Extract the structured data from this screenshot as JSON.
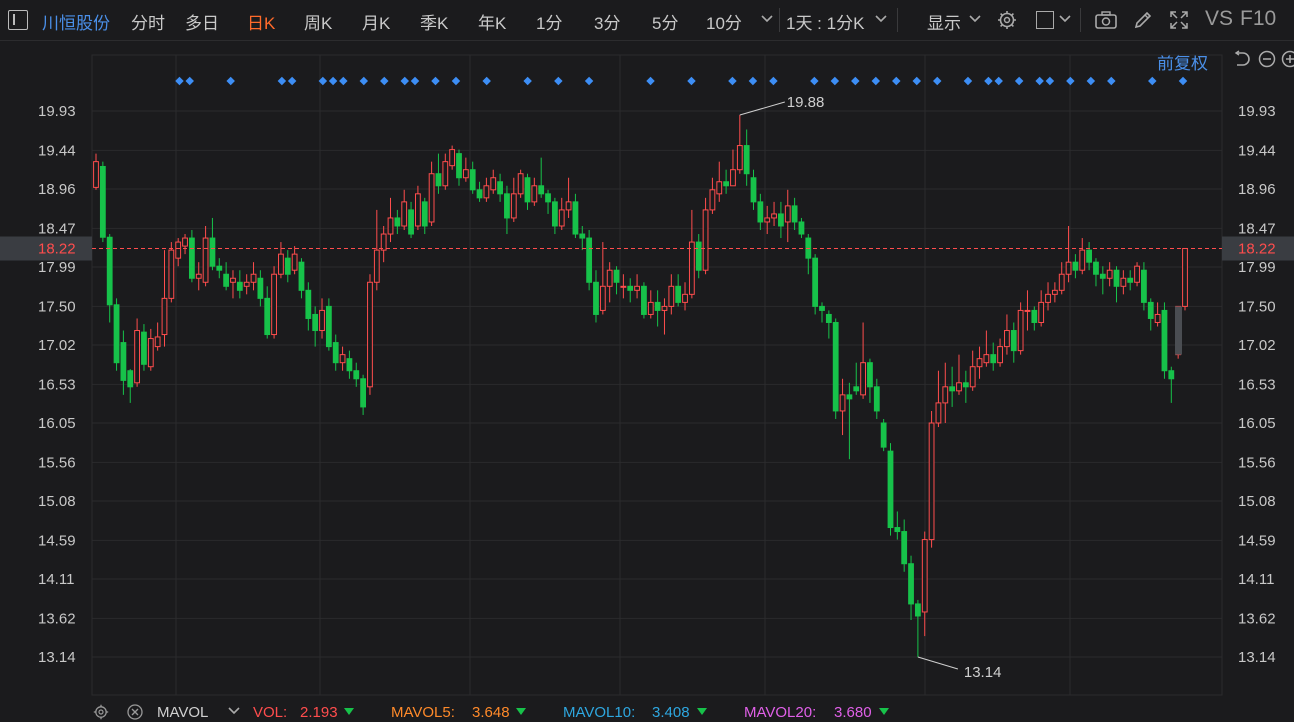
{
  "toolbar": {
    "stock_name": "川恒股份",
    "tabs": [
      "分时",
      "多日",
      "日K",
      "周K",
      "月K",
      "季K",
      "年K",
      "1分",
      "3分",
      "5分",
      "10分"
    ],
    "active_tab": "日K",
    "more": "chevron-down",
    "interval_select": "1天 : 1分K",
    "display_menu": "显示",
    "right_labels": [
      "VS",
      "F10"
    ],
    "icons": [
      "settings-icon",
      "box-toggle-icon",
      "camera-icon",
      "pencil-icon",
      "fullscreen-icon"
    ]
  },
  "adjustment": {
    "label": "前复权",
    "icons": [
      "undo-icon",
      "minus-circle-icon",
      "plus-circle-icon"
    ]
  },
  "colors": {
    "up": "#ff4d4d",
    "down": "#17c24a",
    "last_price": "#ff4d4d",
    "marker": "#3d8ef5",
    "grid": "#2b2b2d",
    "axis_text": "#c8c8c8"
  },
  "chart_data": {
    "type": "candlestick",
    "y_ticks": [
      "19.93",
      "19.44",
      "18.96",
      "18.47",
      "17.99",
      "17.50",
      "17.02",
      "16.53",
      "16.05",
      "15.56",
      "15.08",
      "14.59",
      "14.11",
      "13.62",
      "13.14"
    ],
    "ylim": [
      13.14,
      19.93
    ],
    "last_price": "18.22",
    "high_label": "19.88",
    "low_label": "13.14",
    "candles": [
      [
        18.98,
        19.3,
        19.4,
        18.95
      ],
      [
        19.24,
        18.36,
        19.3,
        18.3
      ],
      [
        18.36,
        17.52,
        18.4,
        17.3
      ],
      [
        17.52,
        16.8,
        17.6,
        16.7
      ],
      [
        17.05,
        16.58,
        17.2,
        16.4
      ],
      [
        16.7,
        16.5,
        16.72,
        16.3
      ],
      [
        16.55,
        17.2,
        17.35,
        16.5
      ],
      [
        17.18,
        16.78,
        17.28,
        16.7
      ],
      [
        16.75,
        17.1,
        17.22,
        16.7
      ],
      [
        17.0,
        17.12,
        17.3,
        16.95
      ],
      [
        17.15,
        17.6,
        18.2,
        17.0
      ],
      [
        17.6,
        18.2,
        18.3,
        17.55
      ],
      [
        18.1,
        18.3,
        18.35,
        18.0
      ],
      [
        18.25,
        18.35,
        18.4,
        18.15
      ],
      [
        18.35,
        17.85,
        18.45,
        17.8
      ],
      [
        17.85,
        17.9,
        18.05,
        17.7
      ],
      [
        17.8,
        18.35,
        18.5,
        17.75
      ],
      [
        18.35,
        18.0,
        18.6,
        17.95
      ],
      [
        18.0,
        17.95,
        18.1,
        17.85
      ],
      [
        17.9,
        17.75,
        18.05,
        17.7
      ],
      [
        17.8,
        17.85,
        17.95,
        17.6
      ],
      [
        17.8,
        17.7,
        17.95,
        17.6
      ],
      [
        17.75,
        17.8,
        17.9,
        17.65
      ],
      [
        17.8,
        17.9,
        18.05,
        17.7
      ],
      [
        17.85,
        17.6,
        17.95,
        17.5
      ],
      [
        17.6,
        17.15,
        17.75,
        17.1
      ],
      [
        17.15,
        17.9,
        18.0,
        17.1
      ],
      [
        17.9,
        18.15,
        18.3,
        17.85
      ],
      [
        18.1,
        17.9,
        18.2,
        17.8
      ],
      [
        17.95,
        18.15,
        18.25,
        17.9
      ],
      [
        18.05,
        17.7,
        18.1,
        17.6
      ],
      [
        17.7,
        17.35,
        17.8,
        17.2
      ],
      [
        17.4,
        17.2,
        17.5,
        17.0
      ],
      [
        17.2,
        17.45,
        17.6,
        17.1
      ],
      [
        17.5,
        17.0,
        17.6,
        16.95
      ],
      [
        17.05,
        16.8,
        17.15,
        16.7
      ],
      [
        16.8,
        16.9,
        17.0,
        16.7
      ],
      [
        16.85,
        16.7,
        16.95,
        16.6
      ],
      [
        16.7,
        16.6,
        16.8,
        16.5
      ],
      [
        16.6,
        16.25,
        16.65,
        16.15
      ],
      [
        16.5,
        17.8,
        17.9,
        16.4
      ],
      [
        17.8,
        18.2,
        18.7,
        17.7
      ],
      [
        18.2,
        18.4,
        18.5,
        18.05
      ],
      [
        18.4,
        18.6,
        18.85,
        18.3
      ],
      [
        18.6,
        18.5,
        18.7,
        18.4
      ],
      [
        18.5,
        18.8,
        18.95,
        18.45
      ],
      [
        18.7,
        18.4,
        18.8,
        18.35
      ],
      [
        18.5,
        18.9,
        19.0,
        18.45
      ],
      [
        18.8,
        18.5,
        18.85,
        18.4
      ],
      [
        18.55,
        19.15,
        19.3,
        18.5
      ],
      [
        19.15,
        19.0,
        19.4,
        18.9
      ],
      [
        19.0,
        19.3,
        19.4,
        18.95
      ],
      [
        19.25,
        19.45,
        19.5,
        19.2
      ],
      [
        19.4,
        19.1,
        19.45,
        19.0
      ],
      [
        19.1,
        19.2,
        19.35,
        19.05
      ],
      [
        19.2,
        18.95,
        19.3,
        18.9
      ],
      [
        18.95,
        18.85,
        19.05,
        18.8
      ],
      [
        18.85,
        19.0,
        19.1,
        18.8
      ],
      [
        18.95,
        19.1,
        19.2,
        18.9
      ],
      [
        19.05,
        18.9,
        19.15,
        18.8
      ],
      [
        18.9,
        18.6,
        19.0,
        18.4
      ],
      [
        18.6,
        18.9,
        19.1,
        18.55
      ],
      [
        18.9,
        19.15,
        19.2,
        18.85
      ],
      [
        19.1,
        18.8,
        19.15,
        18.7
      ],
      [
        18.8,
        19.0,
        19.1,
        18.75
      ],
      [
        19.0,
        18.9,
        19.35,
        18.85
      ],
      [
        18.9,
        18.8,
        18.95,
        18.65
      ],
      [
        18.8,
        18.5,
        18.85,
        18.4
      ],
      [
        18.5,
        18.7,
        18.85,
        18.45
      ],
      [
        18.7,
        18.8,
        19.1,
        18.6
      ],
      [
        18.8,
        18.4,
        18.9,
        18.35
      ],
      [
        18.4,
        18.35,
        18.5,
        18.2
      ],
      [
        18.35,
        17.8,
        18.45,
        17.7
      ],
      [
        17.8,
        17.4,
        17.95,
        17.3
      ],
      [
        17.45,
        17.75,
        18.3,
        17.4
      ],
      [
        17.75,
        17.95,
        18.05,
        17.55
      ],
      [
        17.95,
        17.8,
        18.0,
        17.65
      ],
      [
        17.75,
        17.75,
        17.9,
        17.6
      ],
      [
        17.75,
        17.7,
        17.85,
        17.55
      ],
      [
        17.7,
        17.75,
        17.9,
        17.6
      ],
      [
        17.75,
        17.4,
        17.8,
        17.35
      ],
      [
        17.4,
        17.55,
        17.7,
        17.35
      ],
      [
        17.55,
        17.45,
        17.7,
        17.25
      ],
      [
        17.45,
        17.5,
        17.6,
        17.15
      ],
      [
        17.5,
        17.75,
        17.9,
        17.4
      ],
      [
        17.75,
        17.55,
        17.9,
        17.5
      ],
      [
        17.55,
        17.65,
        17.8,
        17.45
      ],
      [
        17.65,
        18.3,
        18.7,
        17.6
      ],
      [
        18.3,
        17.95,
        18.4,
        17.85
      ],
      [
        17.95,
        18.7,
        18.85,
        17.9
      ],
      [
        18.7,
        18.95,
        19.1,
        18.65
      ],
      [
        18.9,
        19.05,
        19.3,
        18.8
      ],
      [
        19.05,
        19.0,
        19.2,
        18.9
      ],
      [
        19.0,
        19.2,
        19.45,
        19.0
      ],
      [
        19.2,
        19.5,
        19.88,
        19.15
      ],
      [
        19.5,
        19.15,
        19.7,
        19.0
      ],
      [
        19.1,
        18.8,
        19.2,
        18.7
      ],
      [
        18.8,
        18.55,
        18.9,
        18.45
      ],
      [
        18.55,
        18.6,
        18.75,
        18.4
      ],
      [
        18.6,
        18.65,
        18.8,
        18.5
      ],
      [
        18.65,
        18.5,
        18.8,
        18.35
      ],
      [
        18.55,
        18.75,
        18.95,
        18.3
      ],
      [
        18.75,
        18.55,
        18.85,
        18.45
      ],
      [
        18.55,
        18.4,
        18.6,
        18.35
      ],
      [
        18.35,
        18.1,
        18.4,
        17.9
      ],
      [
        18.1,
        17.5,
        18.15,
        17.4
      ],
      [
        17.5,
        17.45,
        17.55,
        17.3
      ],
      [
        17.4,
        17.3,
        17.45,
        17.1
      ],
      [
        17.3,
        16.2,
        17.35,
        16.1
      ],
      [
        16.2,
        16.4,
        16.6,
        15.9
      ],
      [
        16.4,
        16.35,
        16.55,
        15.6
      ],
      [
        16.5,
        16.45,
        16.8,
        16.4
      ],
      [
        16.4,
        16.8,
        17.3,
        16.35
      ],
      [
        16.8,
        16.5,
        16.85,
        16.3
      ],
      [
        16.5,
        16.2,
        16.6,
        16.1
      ],
      [
        16.05,
        15.75,
        16.1,
        15.7
      ],
      [
        15.7,
        14.75,
        15.8,
        14.65
      ],
      [
        14.75,
        14.7,
        14.95,
        14.6
      ],
      [
        14.7,
        14.3,
        14.85,
        14.2
      ],
      [
        14.3,
        13.8,
        14.4,
        13.6
      ],
      [
        13.8,
        13.65,
        13.85,
        13.14
      ],
      [
        13.7,
        14.6,
        14.7,
        13.4
      ],
      [
        14.6,
        16.05,
        16.2,
        14.5
      ],
      [
        16.05,
        16.3,
        16.7,
        16.0
      ],
      [
        16.3,
        16.5,
        16.8,
        16.05
      ],
      [
        16.5,
        16.45,
        16.75,
        16.25
      ],
      [
        16.45,
        16.55,
        16.9,
        16.4
      ],
      [
        16.55,
        16.5,
        16.7,
        16.3
      ],
      [
        16.5,
        16.75,
        16.95,
        16.45
      ],
      [
        16.75,
        16.85,
        17.0,
        16.6
      ],
      [
        16.8,
        16.9,
        17.2,
        16.75
      ],
      [
        16.9,
        16.8,
        17.05,
        16.7
      ],
      [
        16.8,
        17.0,
        17.1,
        16.75
      ],
      [
        17.0,
        17.2,
        17.4,
        16.9
      ],
      [
        17.2,
        16.95,
        17.3,
        16.8
      ],
      [
        16.95,
        17.45,
        17.55,
        16.9
      ],
      [
        17.45,
        17.45,
        17.7,
        17.2
      ],
      [
        17.45,
        17.3,
        17.5,
        17.2
      ],
      [
        17.3,
        17.55,
        17.7,
        17.25
      ],
      [
        17.55,
        17.65,
        17.8,
        17.45
      ],
      [
        17.65,
        17.7,
        17.8,
        17.55
      ],
      [
        17.7,
        17.9,
        18.05,
        17.65
      ],
      [
        17.9,
        18.05,
        18.5,
        17.8
      ],
      [
        18.05,
        17.95,
        18.15,
        17.85
      ],
      [
        17.95,
        18.2,
        18.35,
        17.9
      ],
      [
        18.2,
        18.05,
        18.3,
        17.95
      ],
      [
        18.05,
        17.9,
        18.1,
        17.75
      ],
      [
        17.9,
        17.85,
        18.0,
        17.65
      ],
      [
        17.85,
        17.95,
        18.05,
        17.75
      ],
      [
        17.95,
        17.75,
        18.0,
        17.55
      ],
      [
        17.75,
        17.85,
        17.95,
        17.65
      ],
      [
        17.85,
        17.8,
        17.95,
        17.7
      ],
      [
        17.8,
        18.0,
        18.05,
        17.75
      ],
      [
        17.95,
        17.55,
        18.05,
        17.45
      ],
      [
        17.55,
        17.35,
        17.6,
        17.2
      ],
      [
        17.3,
        17.4,
        17.55,
        17.25
      ],
      [
        17.45,
        16.7,
        17.55,
        16.6
      ],
      [
        16.7,
        16.6,
        16.75,
        16.3
      ],
      [
        16.9,
        17.5,
        17.5,
        16.85
      ],
      [
        17.5,
        18.22,
        18.22,
        17.45
      ]
    ],
    "markers": [
      2,
      3,
      7,
      12,
      13,
      16,
      17,
      18,
      20,
      22,
      24,
      25,
      27,
      29,
      32,
      36,
      39,
      42,
      48,
      52,
      56,
      58,
      60,
      64,
      66,
      68,
      70,
      72,
      74,
      76,
      79,
      81,
      82,
      84,
      86,
      87,
      89,
      91,
      93,
      97,
      100
    ],
    "volume_indicator": {
      "name": "MAVOL",
      "items": [
        {
          "label": "VOL:",
          "value": "2.193",
          "color": "#ff4d4d"
        },
        {
          "label": "MAVOL5:",
          "value": "3.648",
          "color": "#ff8a2a"
        },
        {
          "label": "MAVOL10:",
          "value": "3.408",
          "color": "#2ea7e0"
        },
        {
          "label": "MAVOL20:",
          "value": "3.680",
          "color": "#e060e8"
        }
      ]
    }
  }
}
